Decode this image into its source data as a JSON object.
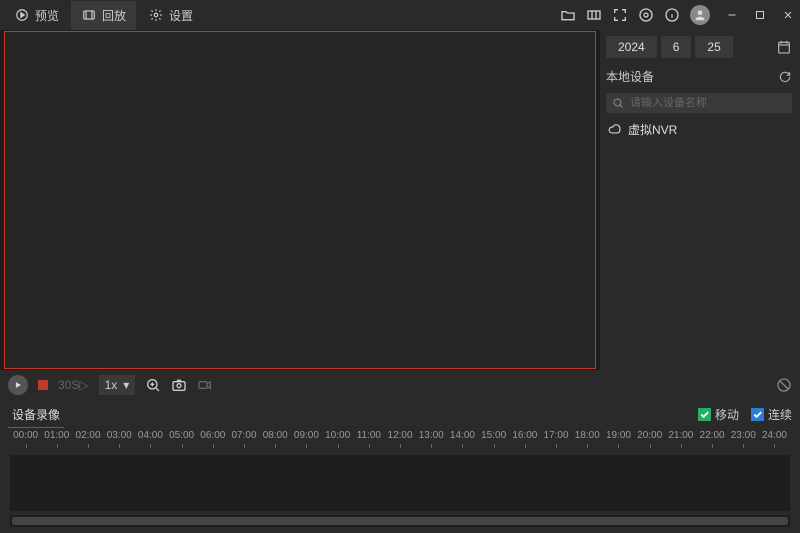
{
  "topbar": {
    "tabs": [
      {
        "label": "预览",
        "icon": "play-circle"
      },
      {
        "label": "回放",
        "icon": "film"
      },
      {
        "label": "设置",
        "icon": "gear"
      }
    ],
    "active_tab_index": 1
  },
  "date": {
    "year": "2024",
    "month": "6",
    "day": "25"
  },
  "side": {
    "section_title": "本地设备",
    "search_placeholder": "请输入设备名称",
    "devices": [
      {
        "name": "虚拟NVR"
      }
    ]
  },
  "controls": {
    "skip_label": "30S",
    "speed_label": "1x"
  },
  "recording": {
    "tab_label": "设备录像",
    "check_motion": "移动",
    "check_cont": "连续"
  },
  "timeline": {
    "hours": [
      "00:00",
      "01:00",
      "02:00",
      "03:00",
      "04:00",
      "05:00",
      "06:00",
      "07:00",
      "08:00",
      "09:00",
      "10:00",
      "11:00",
      "12:00",
      "13:00",
      "14:00",
      "15:00",
      "16:00",
      "17:00",
      "18:00",
      "19:00",
      "20:00",
      "21:00",
      "22:00",
      "23:00",
      "24:00"
    ]
  }
}
